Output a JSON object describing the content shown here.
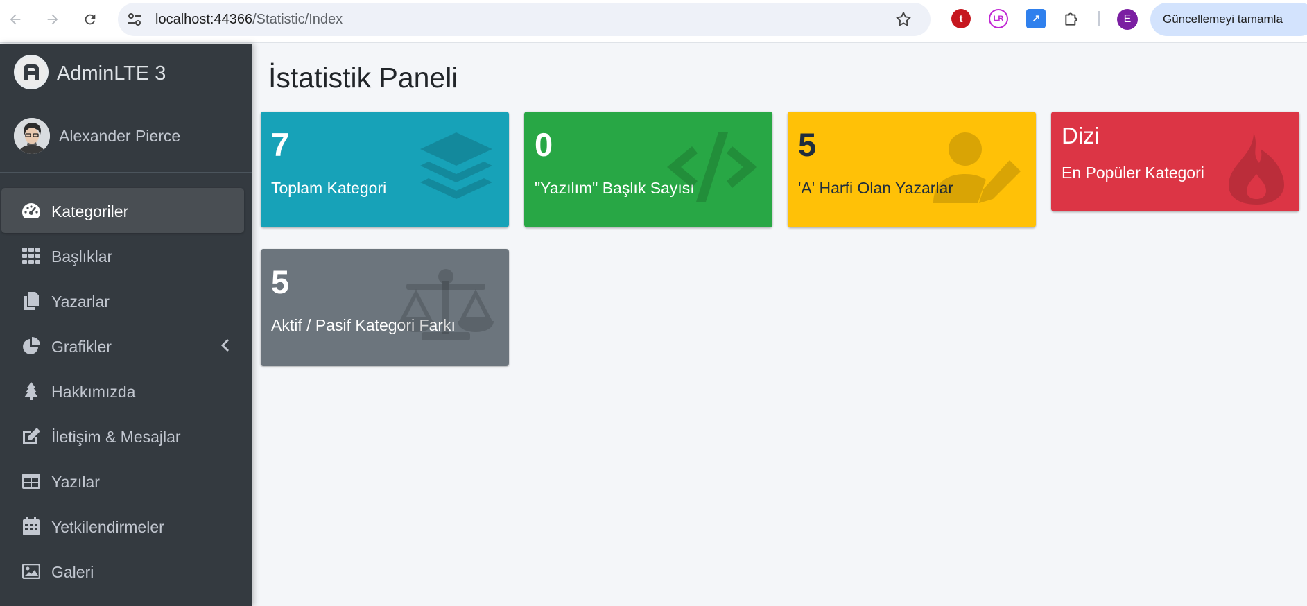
{
  "browser": {
    "url_host": "localhost:44366",
    "url_path": "/Statistic/Index",
    "profile_initial": "E",
    "update_button": "Güncellemeyi tamamla",
    "extensions": [
      {
        "name": "extension-t-icon",
        "glyph": "t",
        "color": "#c6171f"
      },
      {
        "name": "extension-lr-icon",
        "glyph": "LR",
        "color": "#c026d3"
      },
      {
        "name": "extension-resize-icon",
        "glyph": "↗",
        "color": "#2f80ed"
      }
    ]
  },
  "sidebar": {
    "brand": "AdminLTE 3",
    "user_name": "Alexander Pierce",
    "items": [
      {
        "label": "Kategoriler",
        "icon": "tachometer-icon",
        "active": true
      },
      {
        "label": "Başlıklar",
        "icon": "grid-icon",
        "active": false
      },
      {
        "label": "Yazarlar",
        "icon": "copy-icon",
        "active": false
      },
      {
        "label": "Grafikler",
        "icon": "pie-chart-icon",
        "active": false,
        "has_caret": true
      },
      {
        "label": "Hakkımızda",
        "icon": "tree-icon",
        "active": false
      },
      {
        "label": "İletişim & Mesajlar",
        "icon": "edit-icon",
        "active": false
      },
      {
        "label": "Yazılar",
        "icon": "table-icon",
        "active": false
      },
      {
        "label": "Yetkilendirmeler",
        "icon": "calendar-icon",
        "active": false
      },
      {
        "label": "Galeri",
        "icon": "image-icon",
        "active": false
      }
    ]
  },
  "main": {
    "title": "İstatistik Paneli",
    "boxes": [
      {
        "value": "7",
        "label": "Toplam Kategori",
        "color": "#17a2b8",
        "icon": "layers-icon"
      },
      {
        "value": "0",
        "label": "\"Yazılım\" Başlık Sayısı",
        "color": "#28a745",
        "icon": "code-icon"
      },
      {
        "value": "5",
        "label": "'A' Harfi Olan Yazarlar",
        "color": "#ffc107",
        "icon": "user-edit-icon"
      },
      {
        "value": "Dizi",
        "label": "En Popüler Kategori",
        "color": "#dc3545",
        "icon": "fire-icon"
      },
      {
        "value": "5",
        "label": "Aktif / Pasif Kategori Farkı",
        "color": "#6c757d",
        "icon": "balance-scale-icon"
      }
    ]
  }
}
